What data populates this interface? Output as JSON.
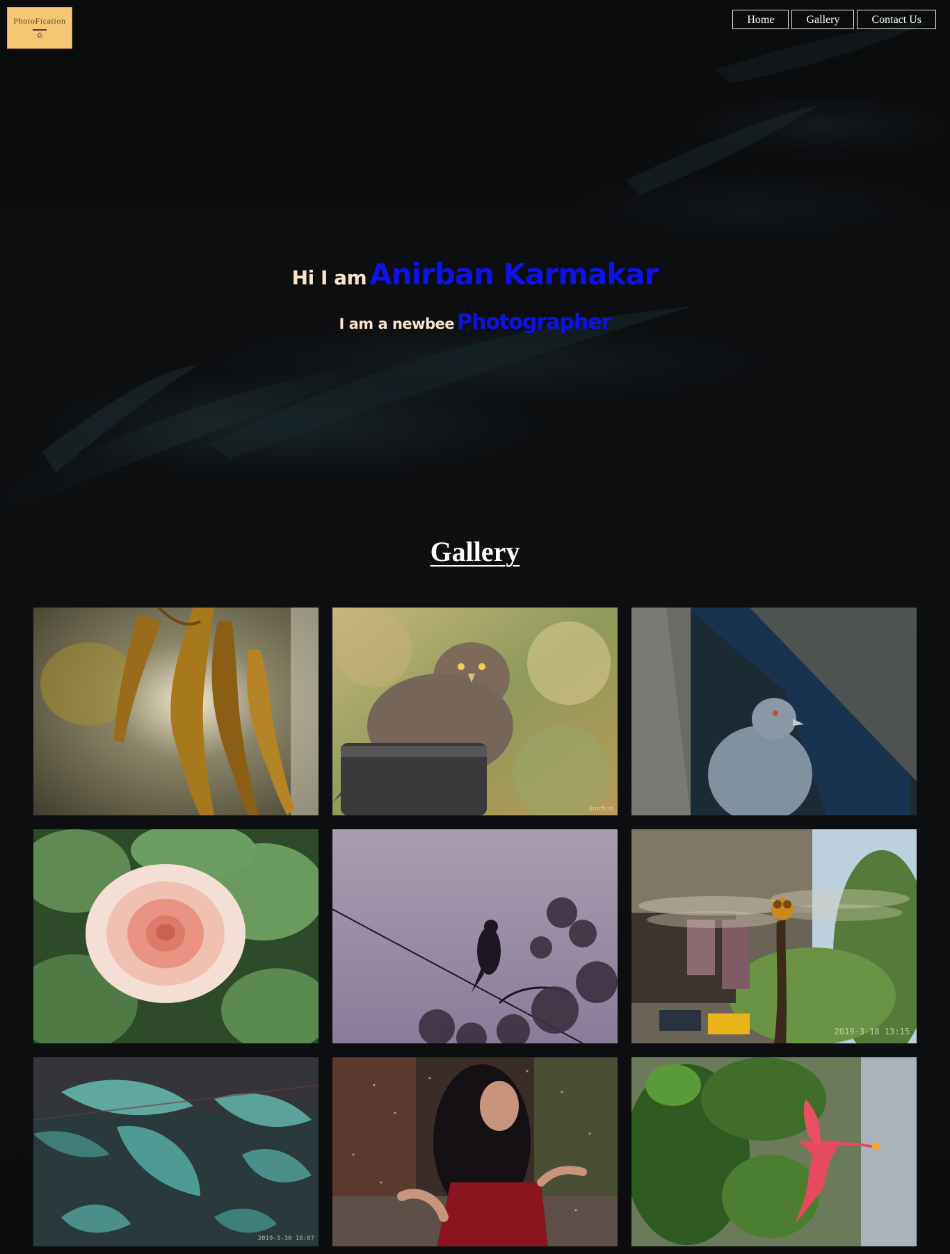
{
  "header": {
    "logo_text": "PhotoFication",
    "logo_icon": "camera-icon",
    "nav": [
      {
        "label": "Home"
      },
      {
        "label": "Gallery"
      },
      {
        "label": "Contact Us"
      }
    ]
  },
  "hero": {
    "greeting": "Hi I am",
    "name": "Anirban Karmakar",
    "tagline": "I am a newbee",
    "role": "Photographer"
  },
  "gallery": {
    "title": "Gallery",
    "photos": [
      {
        "name": "photo-dry-leaves"
      },
      {
        "name": "photo-babbler-bird",
        "watermark": "Anirban"
      },
      {
        "name": "photo-pigeon"
      },
      {
        "name": "photo-dahlia-flower"
      },
      {
        "name": "photo-bird-on-wire"
      },
      {
        "name": "photo-dragonfly",
        "timestamp": "2019-3-18 13:15"
      },
      {
        "name": "photo-teal-leaves",
        "timestamp": "2019-3-30 16:07"
      },
      {
        "name": "photo-woman-in-rain"
      },
      {
        "name": "photo-hibiscus"
      }
    ]
  },
  "colors": {
    "background": "#0c0d0f",
    "accent_name": "#0e12e6",
    "hero_text": "#fbe3cc",
    "logo_bg": "#f3c774"
  }
}
